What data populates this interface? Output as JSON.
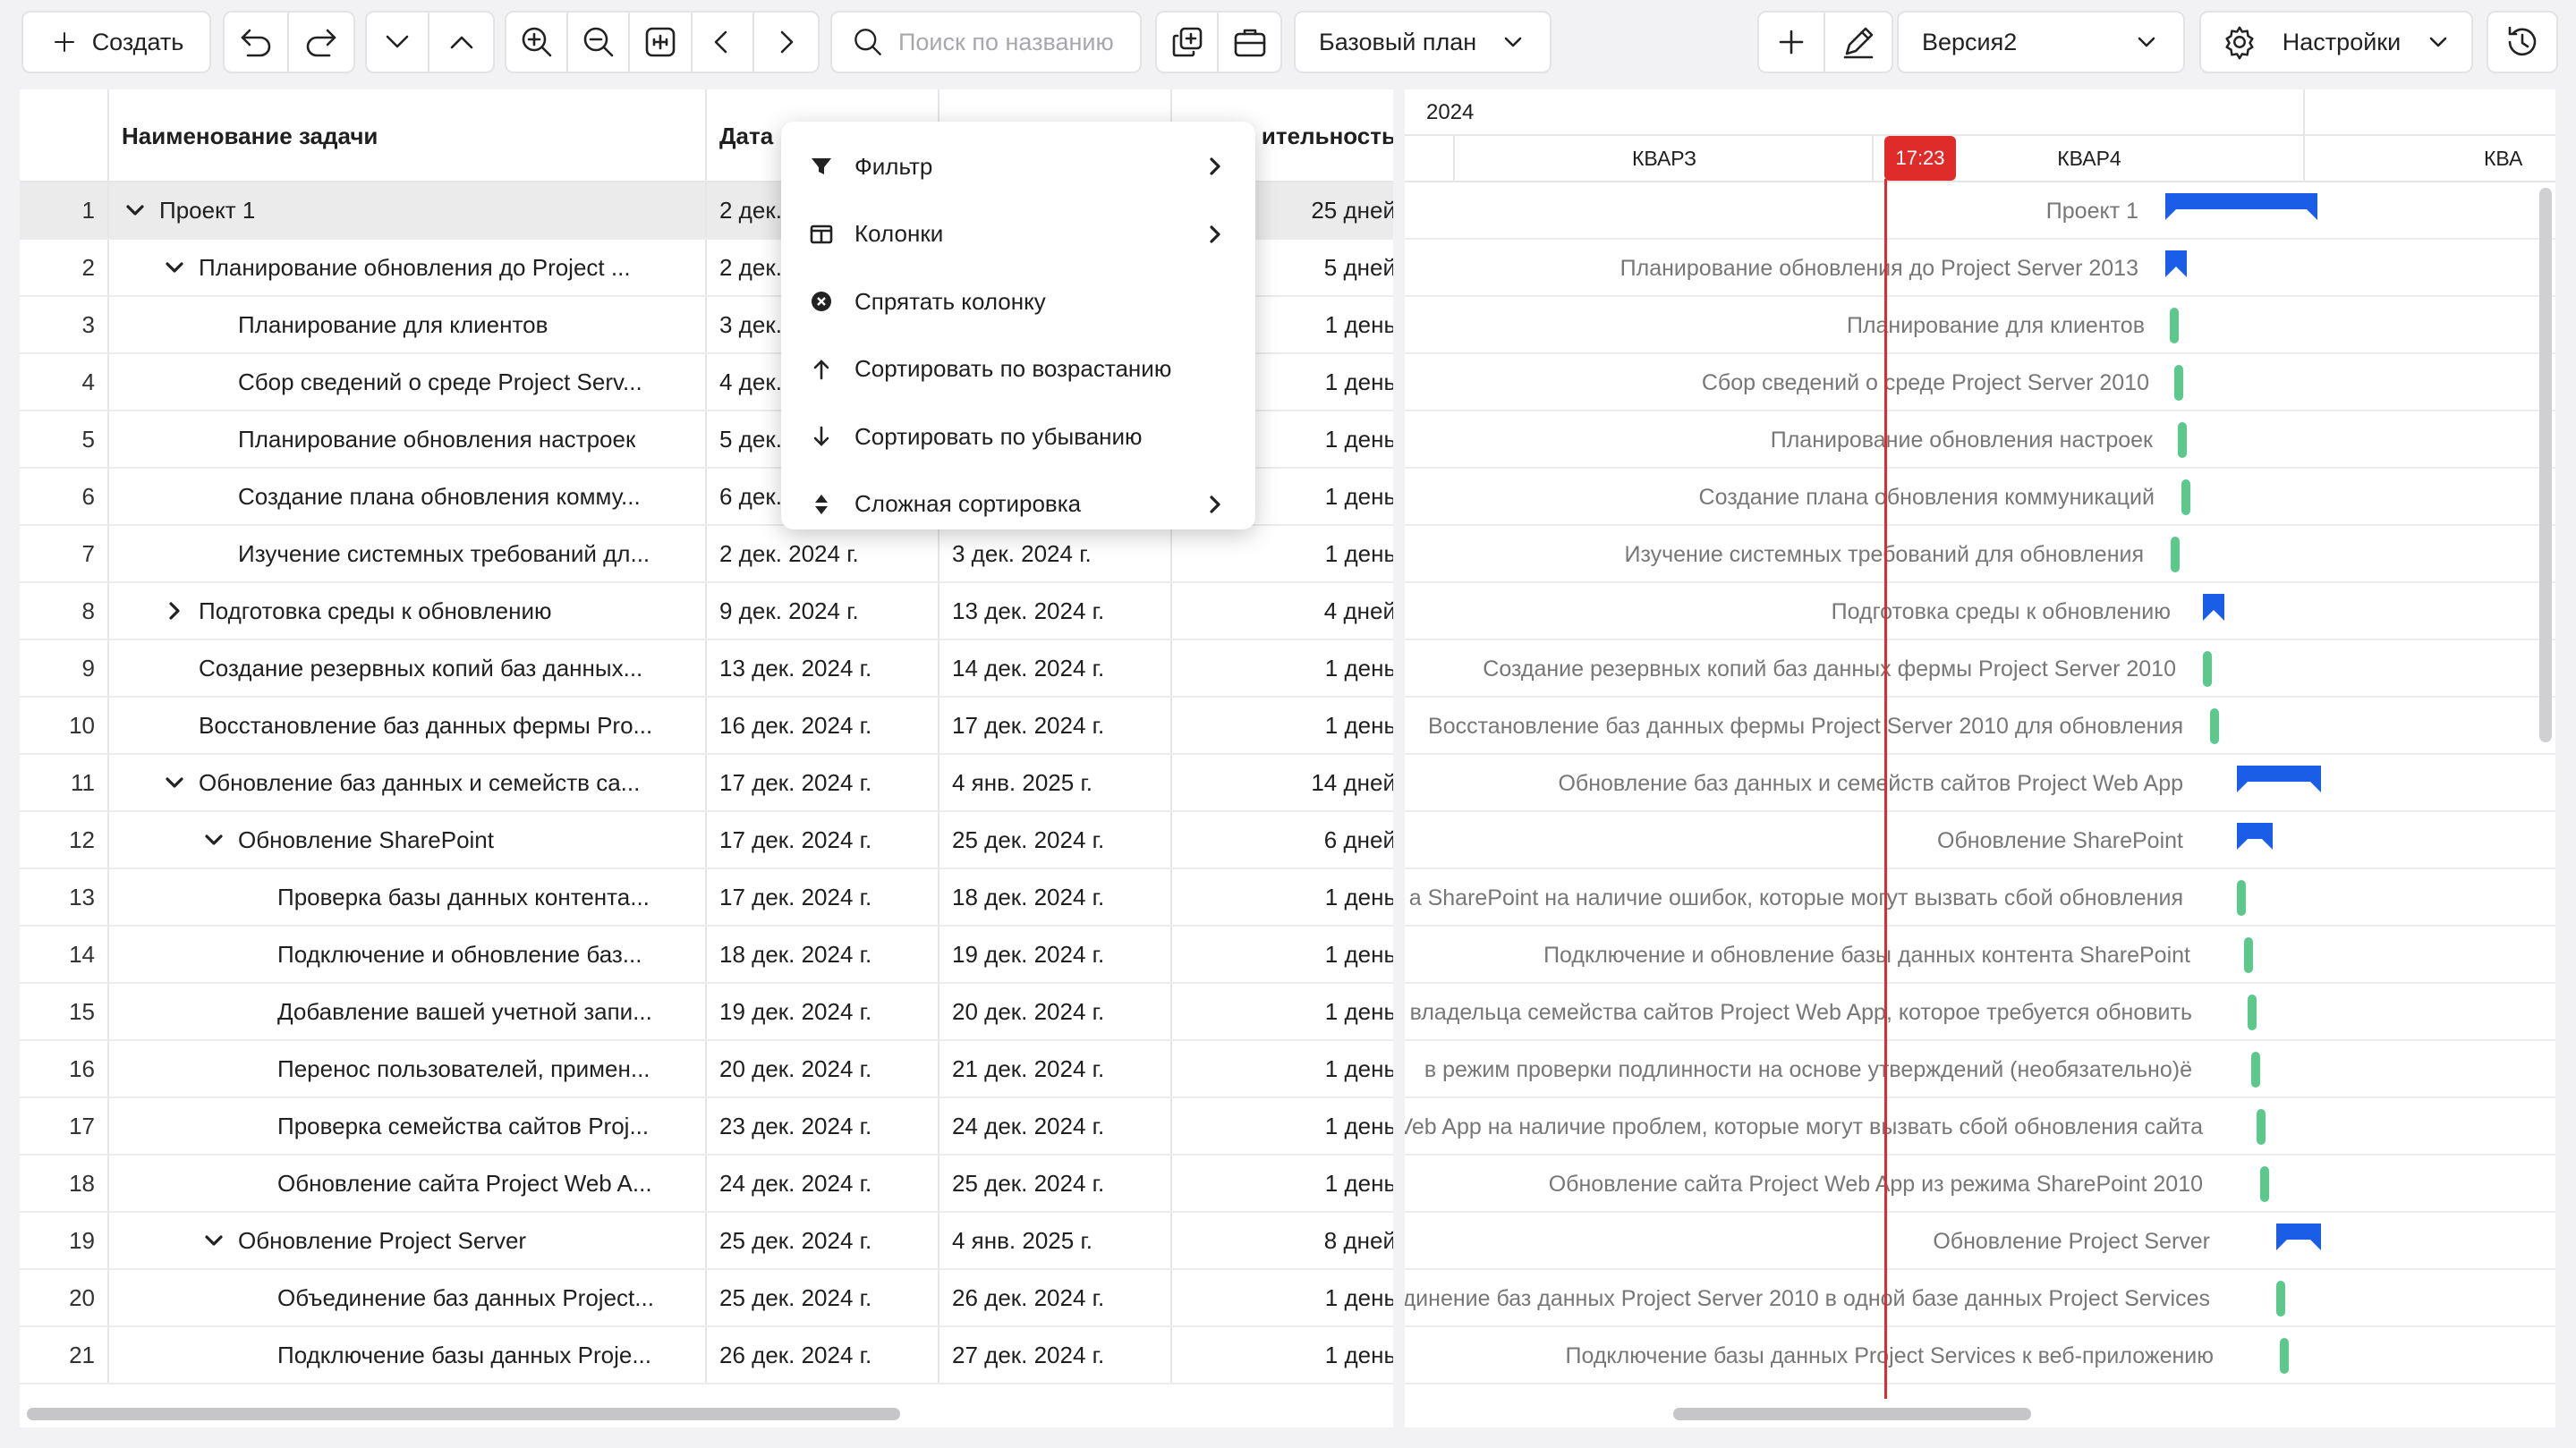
{
  "toolbar": {
    "create_label": "Создать",
    "search_placeholder": "Поиск по названию",
    "baseline_label": "Базовый план",
    "version_label": "Версия2",
    "settings_label": "Настройки"
  },
  "grid": {
    "columns": {
      "name": "Наименование задачи",
      "start": "Дата на",
      "finish": "",
      "duration": "ительность"
    },
    "rows": [
      {
        "num": "1",
        "name": "Проект 1",
        "start": "2 дек. 2",
        "finish": "",
        "duration": "25 дней",
        "toggle": "down"
      },
      {
        "num": "2",
        "name": "Планирование обновления до Project ...",
        "start": "2 дек. 2",
        "finish": "",
        "duration": "5 дней",
        "toggle": "down"
      },
      {
        "num": "3",
        "name": "Планирование для клиентов",
        "start": "3 дек. 2",
        "finish": "",
        "duration": "1 день",
        "toggle": ""
      },
      {
        "num": "4",
        "name": "Сбор сведений о среде Project Serv...",
        "start": "4 дек. 2",
        "finish": "",
        "duration": "1 день",
        "toggle": ""
      },
      {
        "num": "5",
        "name": "Планирование обновления настроек",
        "start": "5 дек. 2",
        "finish": "",
        "duration": "1 день",
        "toggle": ""
      },
      {
        "num": "6",
        "name": "Создание плана обновления комму...",
        "start": "6 дек. 2",
        "finish": "",
        "duration": "1 день",
        "toggle": ""
      },
      {
        "num": "7",
        "name": "Изучение системных требований дл...",
        "start": "2 дек. 2024 г.",
        "finish": "3 дек. 2024 г.",
        "duration": "1 день",
        "toggle": ""
      },
      {
        "num": "8",
        "name": "Подготовка среды к обновлению",
        "start": "9 дек. 2024 г.",
        "finish": "13 дек. 2024 г.",
        "duration": "4 дней",
        "toggle": "right"
      },
      {
        "num": "9",
        "name": "Создание резервных копий баз данных...",
        "start": "13 дек. 2024 г.",
        "finish": "14 дек. 2024 г.",
        "duration": "1 день",
        "toggle": ""
      },
      {
        "num": "10",
        "name": "Восстановление баз данных фермы Pro...",
        "start": "16 дек. 2024 г.",
        "finish": "17 дек. 2024 г.",
        "duration": "1 день",
        "toggle": ""
      },
      {
        "num": "11",
        "name": "Обновление баз данных и семейств са...",
        "start": "17 дек. 2024 г.",
        "finish": "4 янв. 2025 г.",
        "duration": "14 дней",
        "toggle": "down"
      },
      {
        "num": "12",
        "name": "Обновление SharePoint",
        "start": "17 дек. 2024 г.",
        "finish": "25 дек. 2024 г.",
        "duration": "6 дней",
        "toggle": "down"
      },
      {
        "num": "13",
        "name": "Проверка базы данных контента...",
        "start": "17 дек. 2024 г.",
        "finish": "18 дек. 2024 г.",
        "duration": "1 день",
        "toggle": ""
      },
      {
        "num": "14",
        "name": "Подключение и обновление баз...",
        "start": "18 дек. 2024 г.",
        "finish": "19 дек. 2024 г.",
        "duration": "1 день",
        "toggle": ""
      },
      {
        "num": "15",
        "name": "Добавление вашей учетной запи...",
        "start": "19 дек. 2024 г.",
        "finish": "20 дек. 2024 г.",
        "duration": "1 день",
        "toggle": ""
      },
      {
        "num": "16",
        "name": "Перенос пользователей, примен...",
        "start": "20 дек. 2024 г.",
        "finish": "21 дек. 2024 г.",
        "duration": "1 день",
        "toggle": ""
      },
      {
        "num": "17",
        "name": "Проверка семейства сайтов Proj...",
        "start": "23 дек. 2024 г.",
        "finish": "24 дек. 2024 г.",
        "duration": "1 день",
        "toggle": ""
      },
      {
        "num": "18",
        "name": "Обновление сайта Project Web A...",
        "start": "24 дек. 2024 г.",
        "finish": "25 дек. 2024 г.",
        "duration": "1 день",
        "toggle": ""
      },
      {
        "num": "19",
        "name": "Обновление Project Server",
        "start": "25 дек. 2024 г.",
        "finish": "4 янв. 2025 г.",
        "duration": "8 дней",
        "toggle": "down"
      },
      {
        "num": "20",
        "name": "Объединение баз данных Project...",
        "start": "25 дек. 2024 г.",
        "finish": "26 дек. 2024 г.",
        "duration": "1 день",
        "toggle": ""
      },
      {
        "num": "21",
        "name": "Подключение базы данных Proje...",
        "start": "26 дек. 2024 г.",
        "finish": "27 дек. 2024 г.",
        "duration": "1 день",
        "toggle": ""
      }
    ]
  },
  "context_menu": {
    "items": [
      {
        "label": "Фильтр",
        "icon": "filter-icon",
        "submenu": true
      },
      {
        "label": "Колонки",
        "icon": "columns-icon",
        "submenu": true
      },
      {
        "label": "Спрятать колонку",
        "icon": "hide-column-icon",
        "submenu": false
      },
      {
        "label": "Сортировать по возрастанию",
        "icon": "arrow-up-icon",
        "submenu": false
      },
      {
        "label": "Сортировать по убыванию",
        "icon": "arrow-down-icon",
        "submenu": false
      },
      {
        "label": "Сложная сортировка",
        "icon": "sort-icon",
        "submenu": true
      }
    ]
  },
  "timeline": {
    "year": "2024",
    "quarters": [
      "КВАРЗ",
      "КВАР4",
      "КВА"
    ],
    "today_label": "17:23",
    "today_color": "#e02b2b",
    "task_color": "#5cc88b",
    "summary_color": "#1a5ee8",
    "labels": [
      "Проект 1",
      "Планирование обновления до Project Server 2013",
      "Планирование для клиентов",
      "Сбор сведений о среде Project Server 2010",
      "Планирование обновления настроек",
      "Создание плана обновления коммуникаций",
      "Изучение системных требований для обновления",
      "Подготовка среды к обновлению",
      "Создание резервных копий баз данных фермы Project Server 2010",
      "Восстановление баз данных фермы Project Server 2010 для обновления",
      "Обновление баз данных и семейств сайтов Project Web App",
      "Обновление SharePoint",
      "а SharePoint на наличие ошибок, которые могут вызвать сбой обновления",
      "Подключение и обновление базы данных контента SharePoint",
      "владельца семейства сайтов Project Web App, которое требуется обновить",
      "в режим проверки подлинности на основе утверждений (необязательно)ё",
      "Veb App на наличие проблем, которые могут вызвать сбой обновления сайта",
      "Обновление сайта Project Web App из режима SharePoint 2010",
      "Обновление Project Server",
      "динение баз данных Project Server 2010 в одной базе данных Project Services",
      "Подключение базы данных Project Services к веб-приложению"
    ]
  }
}
